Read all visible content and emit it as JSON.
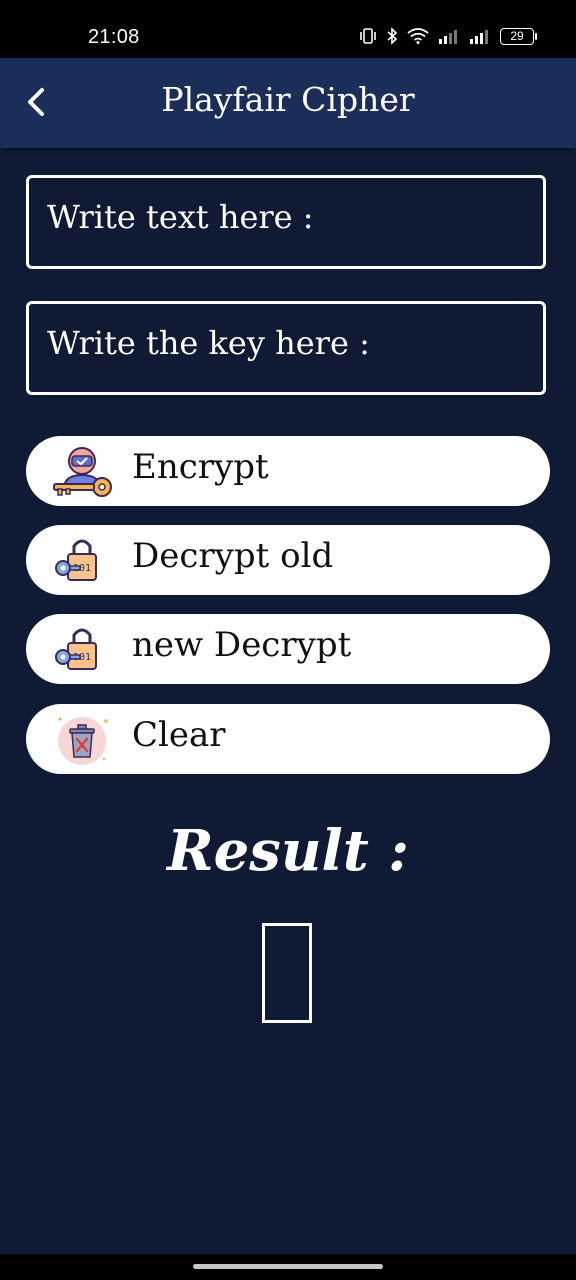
{
  "status_bar": {
    "time": "21:08",
    "battery": "29"
  },
  "app_bar": {
    "title": "Playfair Cipher",
    "back_icon": "chevron-left-icon"
  },
  "form": {
    "text_placeholder": "Write text here :",
    "key_placeholder": "Write the key here :"
  },
  "buttons": [
    {
      "label": "Encrypt",
      "icon": "person-key-icon"
    },
    {
      "label": "Decrypt old",
      "icon": "padlock-key-icon"
    },
    {
      "label": "new Decrypt",
      "icon": "padlock-key-icon"
    },
    {
      "label": "Clear",
      "icon": "trash-icon"
    }
  ],
  "result": {
    "label": "Result :",
    "value_glyph": "missing-glyph-box"
  },
  "colors": {
    "background": "#0f1b35",
    "app_bar": "#1b2e59",
    "button_bg": "#ffffff"
  }
}
